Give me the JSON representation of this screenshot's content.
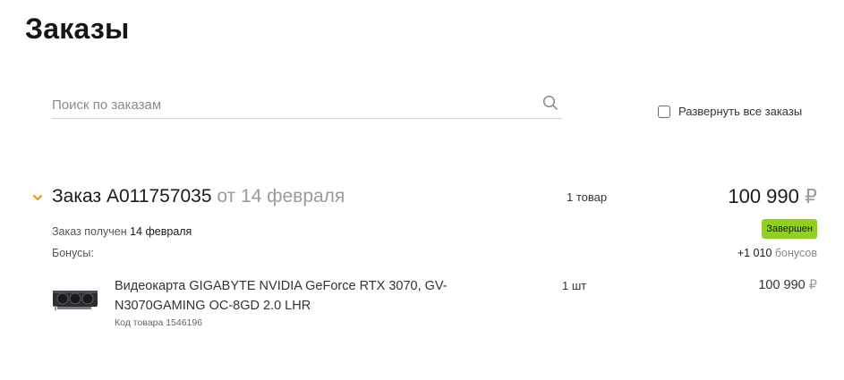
{
  "page": {
    "title": "Заказы"
  },
  "search": {
    "placeholder": "Поиск по заказам",
    "value": ""
  },
  "expand_all": {
    "label": "Развернуть все заказы",
    "checked": false
  },
  "order": {
    "title_prefix": "Заказ",
    "number": "A011757035",
    "date_text": "от 14 февраля",
    "items_count": "1 товар",
    "total": "100 990",
    "currency": "₽",
    "received_label": "Заказ получен",
    "received_date": "14 февраля",
    "status": "Завершен",
    "status_color": "#8fd11c",
    "bonus_label": "Бонусы:",
    "bonus_amount": "+1 010",
    "bonus_unit": "бонусов",
    "toggle_icon": "chevron-down-icon",
    "toggle_color": "#f29100"
  },
  "product": {
    "name": "Видеокарта GIGABYTE NVIDIA GeForce RTX 3070, GV-N3070GAMING OC-8GD 2.0 LHR",
    "code": "Код товара 1546196",
    "quantity": "1 шт",
    "price": "100 990",
    "currency": "₽"
  }
}
